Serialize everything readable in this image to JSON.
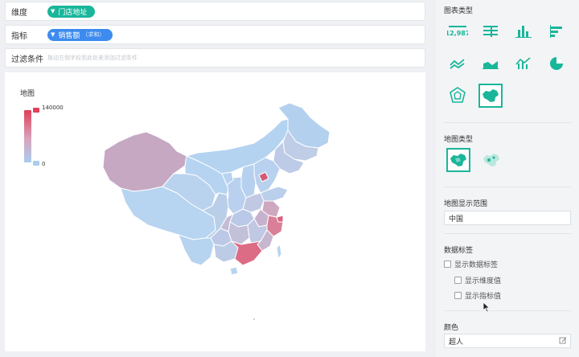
{
  "dimension": {
    "label": "维度",
    "chip": "门店地址"
  },
  "measure": {
    "label": "指标",
    "chip": "销售额",
    "agg": "（求和）"
  },
  "filter": {
    "label": "过滤条件",
    "hint": "拖动左侧字段到此处来添加过滤条件"
  },
  "chart": {
    "title": "地图",
    "legend_max": "140000",
    "legend_min": "0",
    "colors": {
      "high": "#e0405a",
      "mid": "#c8a6c0",
      "low": "#b3d4f1"
    }
  },
  "panel": {
    "chart_type_title": "图表类型",
    "chart_types": [
      "number-card-icon",
      "table-icon",
      "bar-chart-icon",
      "horizontal-bar-icon",
      "line-chart-icon",
      "area-chart-icon",
      "combo-chart-icon",
      "pie-chart-icon",
      "radar-chart-icon",
      "map-chart-icon"
    ],
    "chart_number_sample": "12,987",
    "map_type_title": "地图类型",
    "map_range_title": "地图显示范围",
    "map_range_value": "中国",
    "data_label_title": "数据标签",
    "show_data_label": "显示数据标签",
    "show_dimension_value": "显示维度值",
    "show_measure_value": "显示指标值",
    "color_title": "颜色",
    "color_value": "超人"
  },
  "accent": "#19b69a"
}
